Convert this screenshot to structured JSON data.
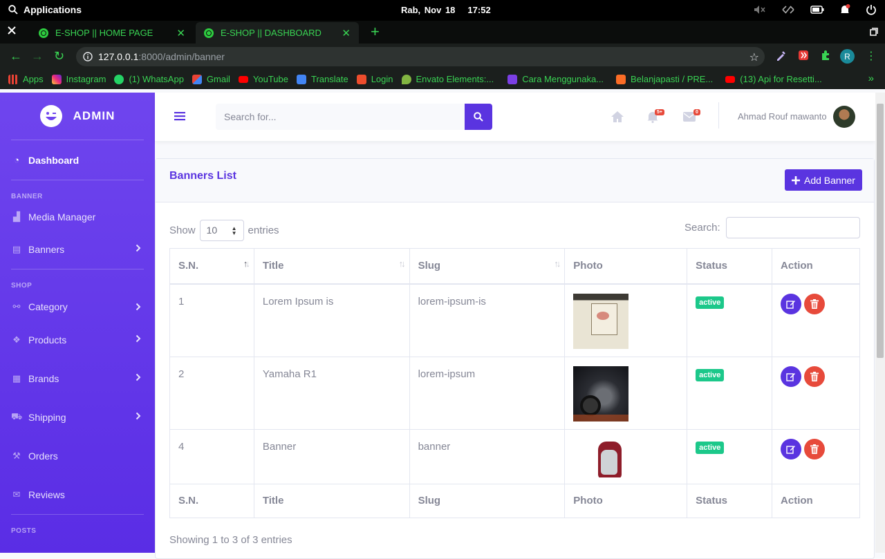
{
  "os": {
    "apps_label": "Applications",
    "date": "Rab, Nov 18",
    "time": "17:52"
  },
  "browser": {
    "tabs": [
      {
        "title": "E-SHOP || HOME PAGE",
        "active": false
      },
      {
        "title": "E-SHOP || DASHBOARD",
        "active": true
      }
    ],
    "url_host": "127.0.0.1",
    "url_path": ":8000/admin/banner",
    "profile_initial": "R",
    "bookmarks": [
      {
        "label": "Apps",
        "icon": "apps-grid-icon",
        "color": "#ea4335"
      },
      {
        "label": "Instagram",
        "icon": "instagram-icon",
        "color": "#e1306c"
      },
      {
        "label": "(1) WhatsApp",
        "icon": "whatsapp-icon",
        "color": "#25d366"
      },
      {
        "label": "Gmail",
        "icon": "gmail-icon",
        "color": "#ea4335"
      },
      {
        "label": "YouTube",
        "icon": "youtube-icon",
        "color": "#ff0000"
      },
      {
        "label": "Translate",
        "icon": "translate-icon",
        "color": "#4285f4"
      },
      {
        "label": "Login",
        "icon": "shopee-icon",
        "color": "#ee4d2d"
      },
      {
        "label": "Envato Elements:...",
        "icon": "envato-icon",
        "color": "#82b541"
      },
      {
        "label": "Cara Menggunaka...",
        "icon": "h-logo-icon",
        "color": "#7b3fe4"
      },
      {
        "label": "Belanjapasti / PRE...",
        "icon": "gitlab-icon",
        "color": "#fc6d26"
      },
      {
        "label": "(13) Api for Resetti...",
        "icon": "youtube-icon",
        "color": "#ff0000"
      }
    ]
  },
  "sidebar": {
    "brand": "ADMIN",
    "dashboard": "Dashboard",
    "heading_banner": "BANNER",
    "media_manager": "Media Manager",
    "banners": "Banners",
    "heading_shop": "SHOP",
    "category": "Category",
    "products": "Products",
    "brands": "Brands",
    "shipping": "Shipping",
    "orders": "Orders",
    "reviews": "Reviews",
    "heading_posts": "POSTS"
  },
  "topbar": {
    "search_placeholder": "Search for...",
    "alerts_count": "5+",
    "messages_count": "0",
    "username": "Ahmad Rouf mawanto"
  },
  "page": {
    "card_title": "Banners List",
    "add_button": "Add Banner",
    "show_label": "Show",
    "entries_label": "entries",
    "page_length": "10",
    "search_label": "Search:",
    "columns": [
      "S.N.",
      "Title",
      "Slug",
      "Photo",
      "Status",
      "Action"
    ],
    "rows": [
      {
        "sn": "1",
        "title": "Lorem Ipsum is",
        "slug": "lorem-ipsum-is",
        "photo": "shirt",
        "status": "active"
      },
      {
        "sn": "2",
        "title": "Yamaha R1",
        "slug": "lorem-ipsum",
        "photo": "moto",
        "status": "active"
      },
      {
        "sn": "4",
        "title": "Banner",
        "slug": "banner",
        "photo": "bag",
        "status": "active"
      }
    ],
    "info": "Showing 1 to 3 of 3 entries"
  },
  "colors": {
    "primary": "#5a34e0",
    "success": "#1cc88a",
    "danger": "#e74a3b",
    "browser_accent": "#39d353"
  }
}
